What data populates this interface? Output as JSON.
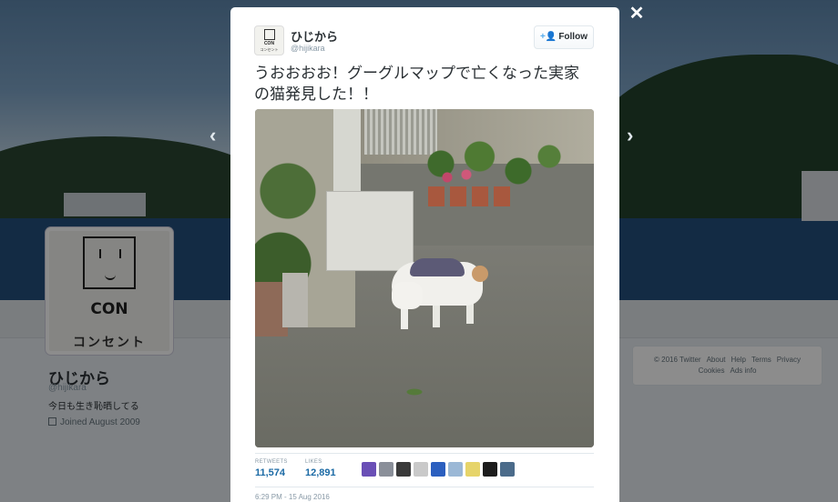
{
  "profile": {
    "name": "ひじから",
    "handle": "@hijikara",
    "bio": "今日も生き恥晒してる",
    "joined": "Joined August 2009",
    "avatar_text": "CON",
    "avatar_kana": "コンセント"
  },
  "footer_links": [
    "© 2016 Twitter",
    "About",
    "Help",
    "Terms",
    "Privacy",
    "Cookies",
    "Ads info"
  ],
  "tweet": {
    "author_name": "ひじから",
    "author_handle": "@hijikara",
    "follow_label": "Follow",
    "text_line1": "うおおおお！グーグルマップで亡くなった実家",
    "text_line2": "の猫発見した！！",
    "retweets_label": "RETWEETS",
    "retweets_count": "11,574",
    "likes_label": "LIKES",
    "likes_count": "12,891",
    "timestamp": "6:29 PM - 15 Aug 2016",
    "liker_colors": [
      "#6a4fb6",
      "#8a8f99",
      "#3a3a3a",
      "#c9c9c9",
      "#2b5fbf",
      "#9bb8d6",
      "#e6d46a",
      "#1d1d1d",
      "#4b6b8a"
    ]
  },
  "icons": {
    "close": "close-icon",
    "prev": "chevron-left-icon",
    "next": "chevron-right-icon",
    "follow": "add-person-icon",
    "calendar": "calendar-icon"
  }
}
